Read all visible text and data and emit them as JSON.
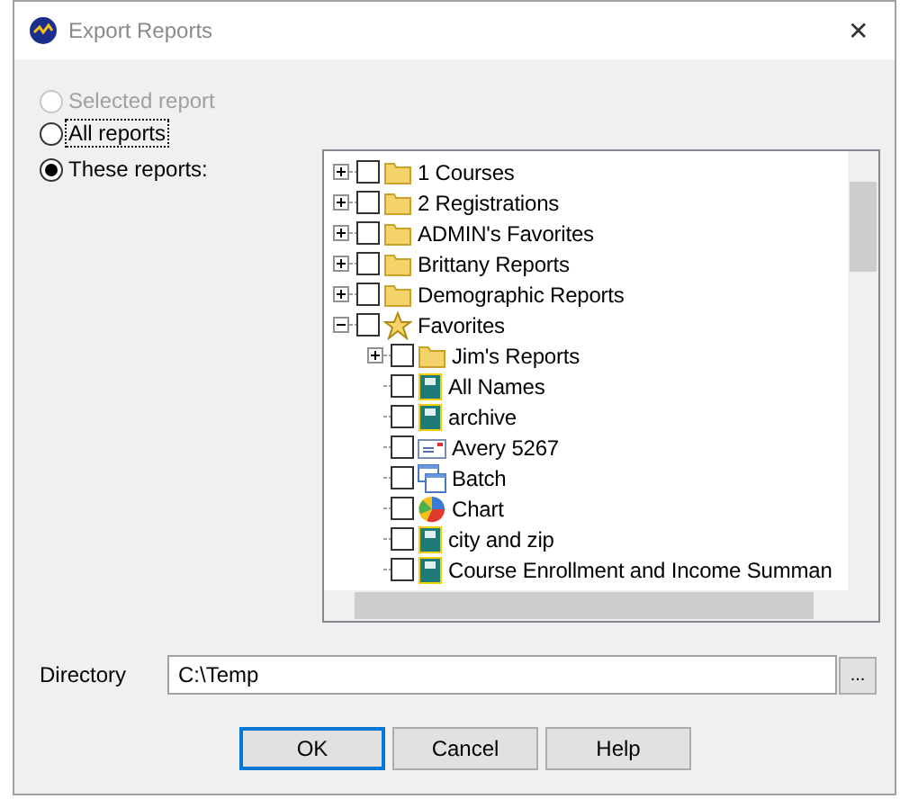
{
  "window": {
    "title": "Export Reports",
    "close": "✕"
  },
  "scope_options": [
    {
      "label": "Selected report",
      "selected": false,
      "disabled": true,
      "focused": false
    },
    {
      "label": "All reports",
      "selected": false,
      "disabled": false,
      "focused": true
    },
    {
      "label": "These reports:",
      "selected": true,
      "disabled": false,
      "focused": false
    }
  ],
  "report_tree": [
    {
      "label": "1 Courses",
      "kind": "folder",
      "checked": false,
      "expanded": false
    },
    {
      "label": "2 Registrations",
      "kind": "folder",
      "checked": false,
      "expanded": false
    },
    {
      "label": "ADMIN's Favorites",
      "kind": "folder",
      "checked": false,
      "expanded": false
    },
    {
      "label": "Brittany Reports",
      "kind": "folder",
      "checked": false,
      "expanded": false
    },
    {
      "label": "Demographic Reports",
      "kind": "folder",
      "checked": false,
      "expanded": false
    },
    {
      "label": "Favorites",
      "kind": "star",
      "checked": false,
      "expanded": true,
      "children": [
        {
          "label": "Jim's Reports",
          "kind": "folder",
          "checked": false,
          "expanded": false
        },
        {
          "label": "All Names",
          "kind": "report",
          "checked": false
        },
        {
          "label": "archive",
          "kind": "report",
          "checked": false
        },
        {
          "label": "Avery 5267",
          "kind": "label",
          "checked": false
        },
        {
          "label": "Batch",
          "kind": "batch",
          "checked": false
        },
        {
          "label": "Chart",
          "kind": "chart",
          "checked": false
        },
        {
          "label": "city and zip",
          "kind": "report",
          "checked": false
        },
        {
          "label": "Course Enrollment and Income Summan",
          "kind": "report",
          "checked": false
        }
      ]
    }
  ],
  "directory": {
    "label": "Directory",
    "value": "C:\\Temp",
    "browse": "..."
  },
  "buttons": [
    {
      "label": "OK",
      "default": true
    },
    {
      "label": "Cancel",
      "default": false
    },
    {
      "label": "Help",
      "default": false
    }
  ]
}
